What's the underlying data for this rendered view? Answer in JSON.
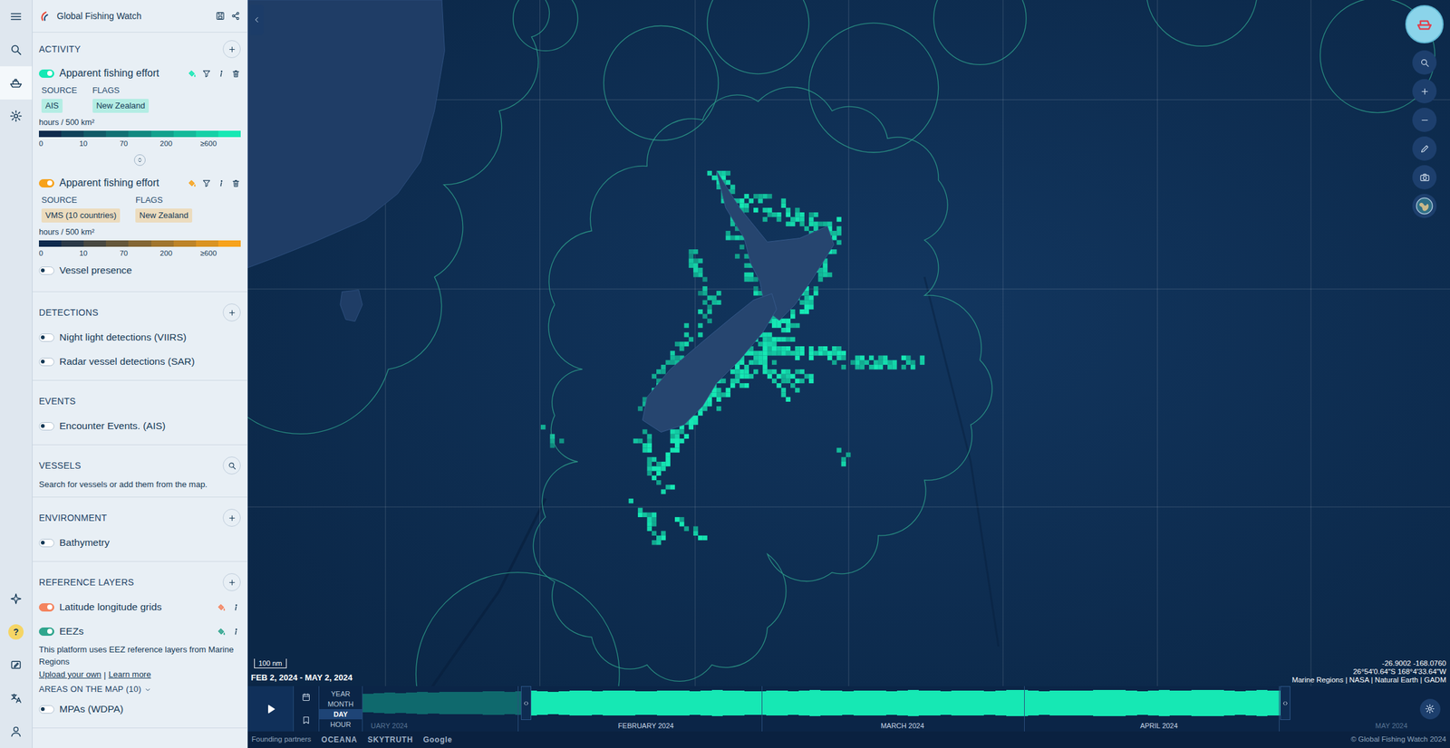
{
  "app": {
    "title": "Global Fishing Watch"
  },
  "rail": {
    "top": [
      {
        "selected": false
      },
      {
        "selected": false
      },
      {
        "selected": true
      },
      {
        "selected": false
      }
    ],
    "bottom": [
      {
        "kind": "icon",
        "selected": false
      },
      {
        "kind": "text",
        "label": "?",
        "selected": false
      },
      {
        "kind": "icon",
        "selected": false
      },
      {
        "kind": "icon",
        "selected": false
      },
      {
        "kind": "icon",
        "selected": false
      }
    ]
  },
  "sections": [
    {
      "title": "ACTIVITY",
      "action": "add",
      "layers": [
        {
          "kind": "heatmap",
          "name": "Apparent fishing effort",
          "on": true,
          "color": "#16e8b4",
          "source_label": "SOURCE",
          "source": "AIS",
          "flags_label": "FLAGS",
          "flag": "New Zealand",
          "unit": "hours / 500 km²",
          "ticks": [
            "0",
            "10",
            "70",
            "200",
            "≥600"
          ]
        },
        {
          "kind": "heatmap",
          "name": "Apparent fishing effort",
          "on": true,
          "color": "#f7a21b",
          "source_label": "SOURCE",
          "source": "VMS (10 countries)",
          "flags_label": "FLAGS",
          "flag": "New Zealand",
          "unit": "hours / 500 km²",
          "ticks": [
            "0",
            "10",
            "70",
            "200",
            "≥600"
          ]
        },
        {
          "kind": "plain",
          "name": "Vessel presence",
          "on": false
        }
      ]
    },
    {
      "title": "DETECTIONS",
      "action": "add",
      "layers": [
        {
          "kind": "plain",
          "name": "Night light detections (VIIRS)",
          "on": false
        },
        {
          "kind": "plain",
          "name": "Radar vessel detections (SAR)",
          "on": false
        }
      ]
    },
    {
      "title": "EVENTS",
      "action": "none",
      "layers": [
        {
          "kind": "plain",
          "name": "Encounter Events. (AIS)",
          "on": false
        }
      ]
    },
    {
      "title": "VESSELS",
      "action": "search",
      "note": "Search for vessels or add them from the map.",
      "layers": []
    },
    {
      "title": "ENVIRONMENT",
      "action": "add",
      "layers": [
        {
          "kind": "plain",
          "name": "Bathymetry",
          "on": false
        }
      ]
    },
    {
      "title": "REFERENCE LAYERS",
      "action": "add",
      "layers": [
        {
          "kind": "reference",
          "name": "Latitude longitude grids",
          "on": true,
          "color": "#f4845f"
        },
        {
          "kind": "reference",
          "name": "EEZs",
          "on": true,
          "color": "#2fa58d",
          "note": "This platform uses EEZ reference layers from Marine Regions",
          "links": [
            "Upload your own",
            "Learn more"
          ],
          "link_separator": "|",
          "areas": "AREAS ON THE MAP (10)"
        },
        {
          "kind": "plain",
          "name": "MPAs (WDPA)",
          "on": false
        }
      ]
    }
  ],
  "map": {
    "scale": "100 nm",
    "coords": [
      "-26.9002 -168.0760",
      "26°54'0.64\"S 168°4'33.64\"W"
    ],
    "attribution": "Marine Regions | NASA | Natural Earth | GADM"
  },
  "timebar": {
    "date_range": "FEB 2, 2024 - MAY 2, 2024",
    "intervals": [
      {
        "label": "YEAR",
        "selected": false
      },
      {
        "label": "MONTH",
        "selected": false
      },
      {
        "label": "DAY",
        "selected": true
      },
      {
        "label": "HOUR",
        "selected": false
      }
    ],
    "months": [
      {
        "label": "UARY 2024",
        "faded": true
      },
      {
        "label": "FEBRUARY 2024",
        "faded": false
      },
      {
        "label": "MARCH 2024",
        "faded": false
      },
      {
        "label": "APRIL 2024",
        "faded": false
      },
      {
        "label": "MAY 2024",
        "faded": true
      }
    ],
    "selection_start": 0.156,
    "selection_end": 0.881,
    "series": [
      1180,
      1240,
      1320,
      1290,
      1350,
      1410,
      1380,
      1450,
      1420,
      1390,
      1460,
      1500,
      1480,
      1420,
      1510,
      1560,
      1530,
      1470,
      1540,
      1590,
      1560,
      1500,
      1580,
      1620,
      1600,
      1540,
      1490,
      1570,
      1610,
      1590,
      1520,
      1600,
      1640,
      1610,
      1560,
      1480,
      1550,
      1600,
      1580,
      1530,
      1610,
      1650,
      1620,
      1570,
      1500,
      1560,
      1610,
      1590,
      1540,
      1620,
      1660,
      1630,
      1580,
      1520,
      1570,
      1620,
      1600,
      1550,
      1630,
      1670,
      1640,
      1590,
      1530,
      1580,
      1630,
      1610,
      1560,
      1640,
      1680,
      1650,
      1600,
      1540,
      1590,
      1640,
      1620,
      1570,
      1650,
      1690,
      1660,
      1610,
      1550,
      1600,
      1650,
      1630,
      1580,
      0,
      0,
      0,
      0,
      0,
      0,
      0,
      0,
      0,
      0,
      0
    ]
  },
  "footer": {
    "partners_label": "Founding partners",
    "partners": [
      "OCEANA",
      "SKYTRUTH",
      "Google"
    ],
    "copyright": "© Global Fishing Watch 2024"
  }
}
